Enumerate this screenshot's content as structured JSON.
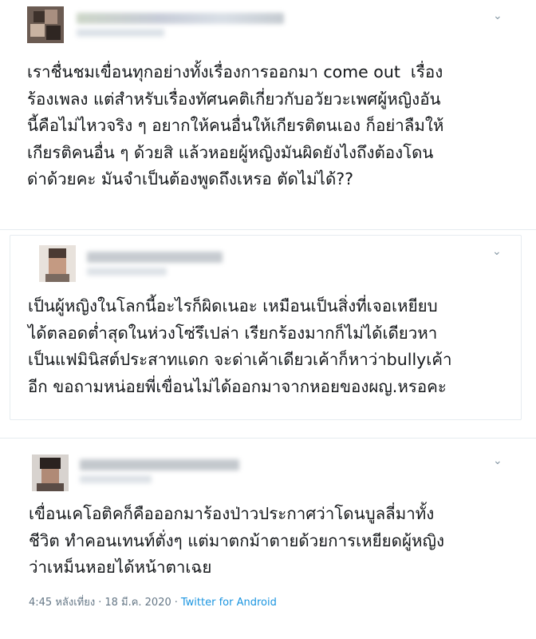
{
  "tweets": [
    {
      "text": "เราชื่นชมเขื่อนทุกอย่างทั้งเรื่องการออกมา come out  เรื่องร้องเพลง แต่สำหรับเรื่องทัศนคติเกี่ยวกับอวัยวะเพศผู้หญิงอันนี้คือไม่ไหวจริง ๆ อยากให้คนอื่นให้เกียรติตนเอง ก็อย่าลืมให้เกียรติคนอื่น ๆ ด้วยสิ แล้วหอยผู้หญิงมันผิดยังไงถึงต้องโดนด่าด้วยคะ มันจำเป็นต้องพูดถึงเหรอ ตัดไม่ได้??",
      "lines": [
        "เราชื่นชมเขื่อนทุกอย่างทั้งเรื่องการออกมา come out  เรื่อง",
        "ร้องเพลง แต่สำหรับเรื่องทัศนคติเกี่ยวกับอวัยวะเพศผู้หญิงอัน",
        "นี้คือไม่ไหวจริง ๆ อยากให้คนอื่นให้เกียรติตนเอง ก็อย่าลืมให้",
        "เกียรติคนอื่น ๆ ด้วยสิ แล้วหอยผู้หญิงมันผิดยังไงถึงต้องโดน",
        "ด่าด้วยคะ มันจำเป็นต้องพูดถึงเหรอ ตัดไม่ได้??"
      ],
      "menu_icon": "chevron-down-icon"
    },
    {
      "text": "เป็นผู้หญิงในโลกนี้อะไรก็ผิดเนอะ เหมือนเป็นสิ่งที่เจอเหยียบได้ตลอดต่ำสุดในห่วงโซ่รึเปล่า เรียกร้องมากก็ไม่ได้เดียวหาเป็นแฟมินิสต์ประสาทแดก จะด่าเค้าเดียวเค้าก็หาว่าbullyเค้าอีก ขอถามหน่อยพี่เขื่อนไม่ได้ออกมาจากหอยของผญ.หรอคะ",
      "lines": [
        "เป็นผู้หญิงในโลกนี้อะไรก็ผิดเนอะ เหมือนเป็นสิ่งที่เจอเหยียบ",
        "ได้ตลอดต่ำสุดในห่วงโซ่รึเปล่า เรียกร้องมากก็ไม่ได้เดียวหา",
        "เป็นแฟมินิสต์ประสาทแดก จะด่าเค้าเดียวเค้าก็หาว่าbullyเค้า",
        "อีก ขอถามหน่อยพี่เขื่อนไม่ได้ออกมาจากหอยของผญ.หรอคะ"
      ],
      "menu_icon": "chevron-down-icon"
    },
    {
      "text": "เขื่อนเคโอติคก็คือออกมาร้องป่าวประกาศว่าโดนบูลลี่มาทั้งชีวิต ทำคอนเทนท์ตั่งๆ แต่มาตกม้าตายด้วยการเหยียดผู้หญิงว่าเหม็นหอยได้หน้าตาเฉย",
      "lines": [
        "เขื่อนเคโอติคก็คือออกมาร้องป่าวประกาศว่าโดนบูลลี่มาทั้ง",
        "ชีวิต ทำคอนเทนท์ตั่งๆ แต่มาตกม้าตายด้วยการเหยียดผู้หญิง",
        "ว่าเหม็นหอยได้หน้าตาเฉย"
      ],
      "time": "4:45 หลังเที่ยง",
      "separator": "·",
      "date": "18 มี.ค. 2020",
      "source": "Twitter for Android",
      "menu_icon": "chevron-down-icon"
    }
  ],
  "colors": {
    "text": "#14171a",
    "muted": "#657786",
    "link": "#1b95e0",
    "border": "#e6ecf0"
  }
}
